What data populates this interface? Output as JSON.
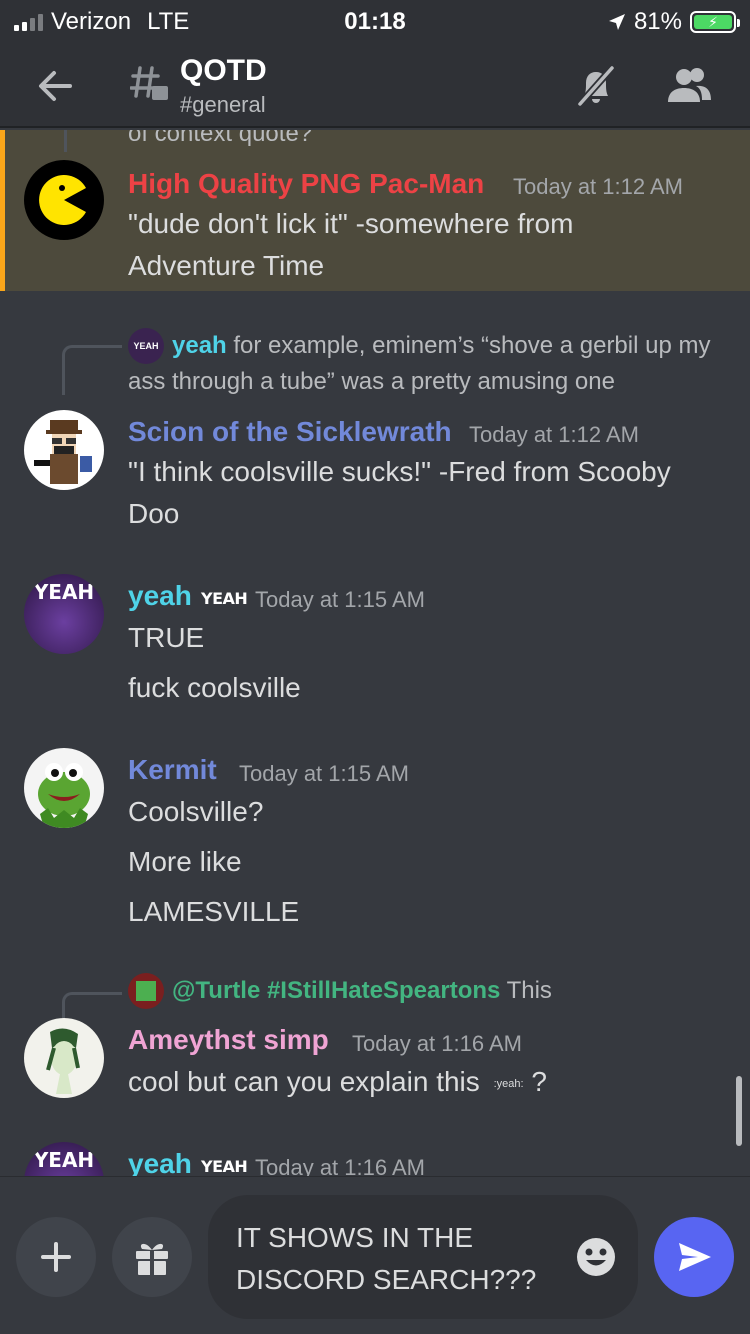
{
  "status_bar": {
    "carrier": "Verizon",
    "network": "LTE",
    "time": "01:18",
    "battery": "81%"
  },
  "header": {
    "channel_title": "QOTD",
    "channel_subtitle": "#general"
  },
  "messages": {
    "cut_text": "of context quote?",
    "m1": {
      "author": "High Quality PNG Pac-Man",
      "author_color": "#ed4245",
      "timestamp": "Today at 1:12 AM",
      "text": "\"dude don't lick it\" -somewhere from Adventure Time"
    },
    "m2": {
      "reply_author": "yeah",
      "reply_text": "for example, eminem’s “shove a gerbil up my ass through a tube” was a pretty amusing one",
      "author": "Scion of the Sicklewrath",
      "author_color": "#7289da",
      "timestamp": "Today at 1:12 AM",
      "text": "\"I think coolsville sucks!\" -Fred from Scooby Doo"
    },
    "m3": {
      "author": "yeah",
      "author_color": "#4fd3e8",
      "tag": "YEAH",
      "timestamp": "Today at 1:15 AM",
      "text1": "TRUE",
      "text2": "fuck coolsville"
    },
    "m4": {
      "author": "Kermit",
      "author_color": "#7289da",
      "timestamp": "Today at 1:15 AM",
      "text1": "Coolsville?",
      "text2": "More like",
      "text3": "LAMESVILLE"
    },
    "m5": {
      "reply_author": "@Turtle #IStillHateSpeartons",
      "reply_author_color": "#43b581",
      "reply_text": "This",
      "author": "Ameythst simp",
      "author_color": "#f0a4d4",
      "timestamp": "Today at 1:16 AM",
      "text": "cool but can you explain this",
      "emoji_text": ":yeah:",
      "text_end": "?"
    },
    "m6": {
      "author": "yeah",
      "author_color": "#4fd3e8",
      "tag": "YEAH",
      "timestamp": "Today at 1:16 AM"
    },
    "avatar_badge": "YEAH"
  },
  "composer": {
    "input_value": "IT SHOWS IN THE DISCORD SEARCH???"
  },
  "colors": {
    "background": "#36393f",
    "header": "#2f3136",
    "highlight": "#4d4a3c",
    "highlight_bar": "#faa61a",
    "send_button": "#5865f2"
  }
}
